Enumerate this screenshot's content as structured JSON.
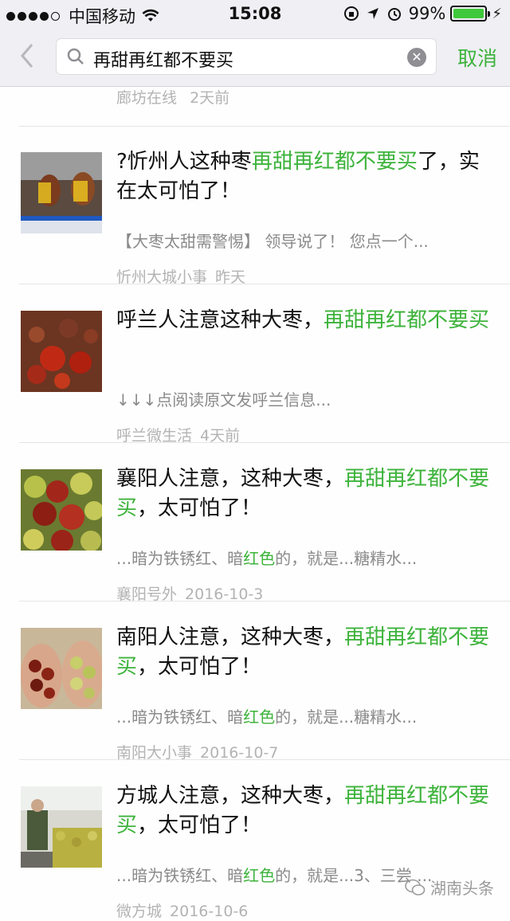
{
  "status_bar": {
    "carrier": "中国移动",
    "time": "15:08",
    "battery_percent": "99%",
    "battery_level": 0.99
  },
  "search": {
    "query": "再甜再红都不要买",
    "cancel_label": "取消"
  },
  "top_item": {
    "source": "廊坊在线",
    "date": "2天前"
  },
  "items": [
    {
      "title_parts": [
        "?忻州人这种枣",
        "再甜再红都不要买",
        "了，实在太可怕了！"
      ],
      "digest_parts": [
        "【大枣太甜需警惕】 领导说了！ 您点一个...",
        "",
        ""
      ],
      "source": "忻州大城小事",
      "date": "昨天"
    },
    {
      "title_parts": [
        "呼兰人注意这种大枣，",
        "再甜再红都不要买",
        ""
      ],
      "digest_parts": [
        "↓↓↓点阅读原文发呼兰信息...",
        "",
        ""
      ],
      "source": "呼兰微生活",
      "date": "4天前"
    },
    {
      "title_parts": [
        "襄阳人注意，这种大枣，",
        "再甜再红都不要买",
        "，太可怕了！"
      ],
      "digest_parts": [
        "...暗为铁锈红、暗",
        "红色",
        "的，就是...糖精水..."
      ],
      "source": "襄阳号外",
      "date": "2016-10-3"
    },
    {
      "title_parts": [
        "南阳人注意，这种大枣，",
        "再甜再红都不要买",
        "，太可怕了！"
      ],
      "digest_parts": [
        "...暗为铁锈红、暗",
        "红色",
        "的，就是...糖精水..."
      ],
      "source": "南阳大小事",
      "date": "2016-10-7"
    },
    {
      "title_parts": [
        "方城人注意，这种大枣，",
        "再甜再红都不要买",
        "，太可怕了！"
      ],
      "digest_parts": [
        "...暗为铁锈红、暗",
        "红色",
        "的，就是...3、三尝 ..."
      ],
      "source": "微方城",
      "date": "2016-10-6"
    }
  ],
  "watermark": "湖南头条",
  "colors": {
    "accent_green": "#3db33b",
    "meta_gray": "#b3b3b3",
    "background": "#efeff4"
  }
}
